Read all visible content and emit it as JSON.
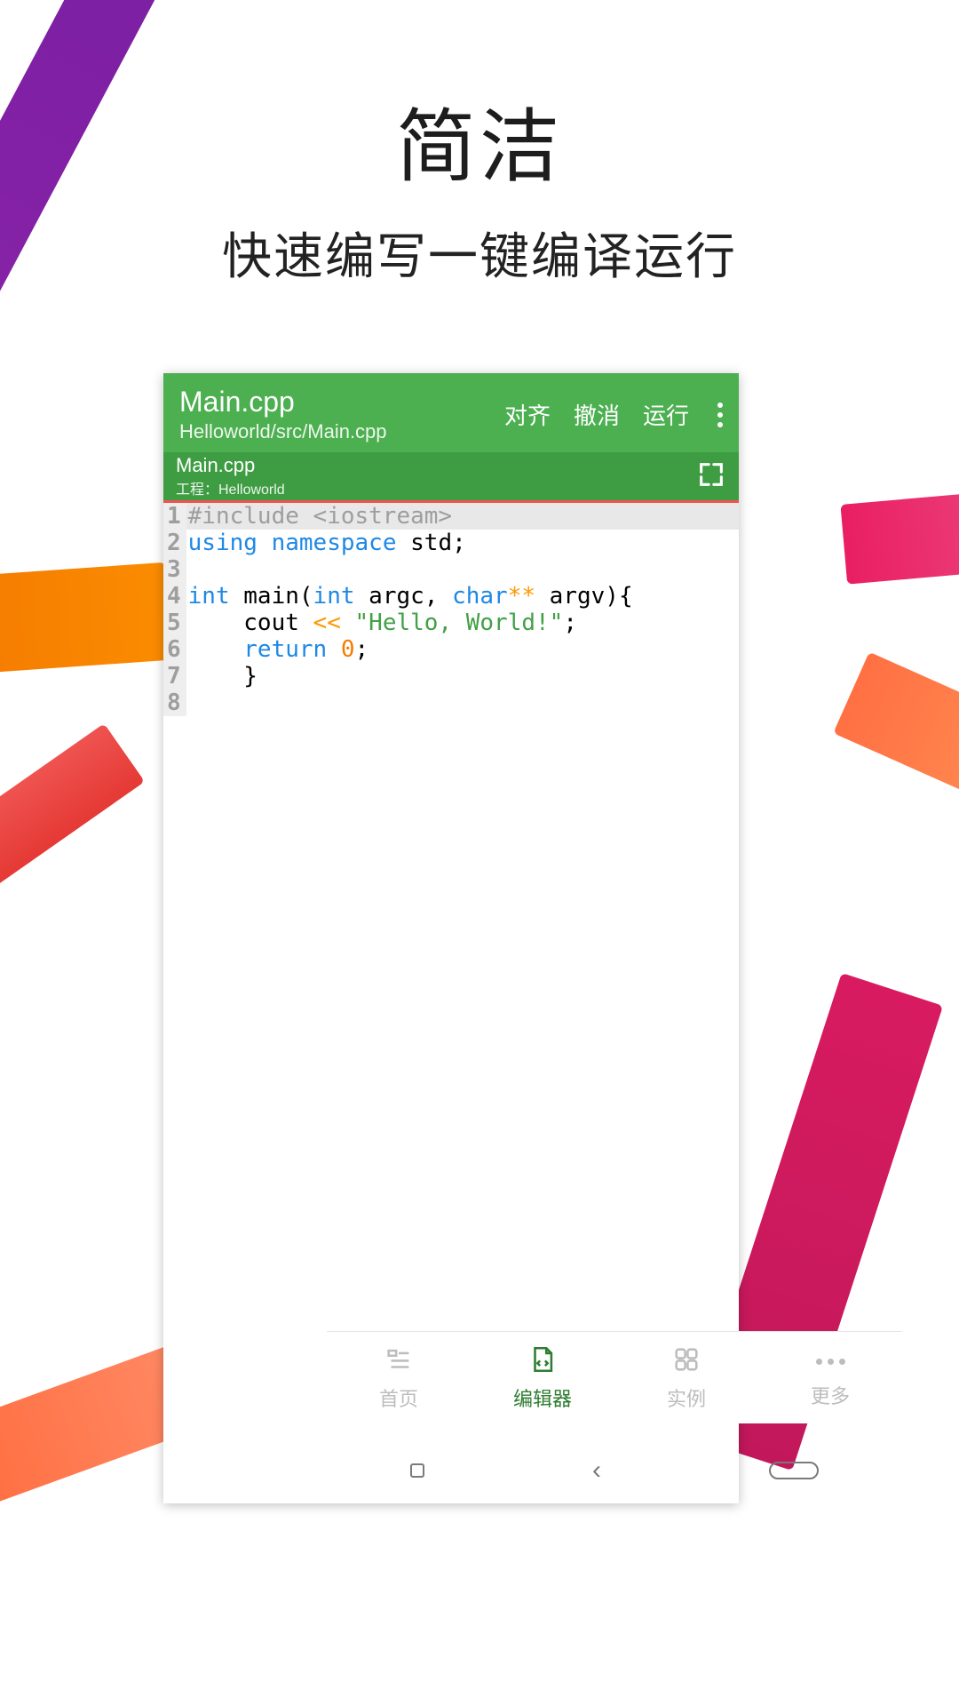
{
  "headline": "简洁",
  "subtitle": "快速编写一键编译运行",
  "editor": {
    "file_title": "Main.cpp",
    "file_path": "Helloworld/src/Main.cpp",
    "actions": {
      "align": "对齐",
      "undo": "撤消",
      "run": "运行"
    },
    "tab": {
      "name": "Main.cpp",
      "project": "工程：Helloworld"
    },
    "gutter": [
      "1",
      "2",
      "3",
      "4",
      "5",
      "6",
      "7",
      "8"
    ]
  },
  "code": {
    "l1_include": "#include <iostream>",
    "l2_using": "using",
    "l2_namespace": "namespace",
    "l2_std": " std;",
    "l4_int": "int",
    "l4_main": " main(",
    "l4_int2": "int",
    "l4_argc": " argc, ",
    "l4_char": "char",
    "l4_stars": "**",
    "l4_argv": " argv){",
    "l5_indent": "    cout ",
    "l5_op": "<<",
    "l5_sp": " ",
    "l5_str": "\"Hello, World!\"",
    "l5_semi": ";",
    "l6_indent": "    ",
    "l6_return": "return",
    "l6_sp": " ",
    "l6_zero": "0",
    "l6_semi": ";",
    "l7_brace": "    }"
  },
  "nav": {
    "home": "首页",
    "editor": "编辑器",
    "examples": "实例",
    "more": "更多"
  }
}
